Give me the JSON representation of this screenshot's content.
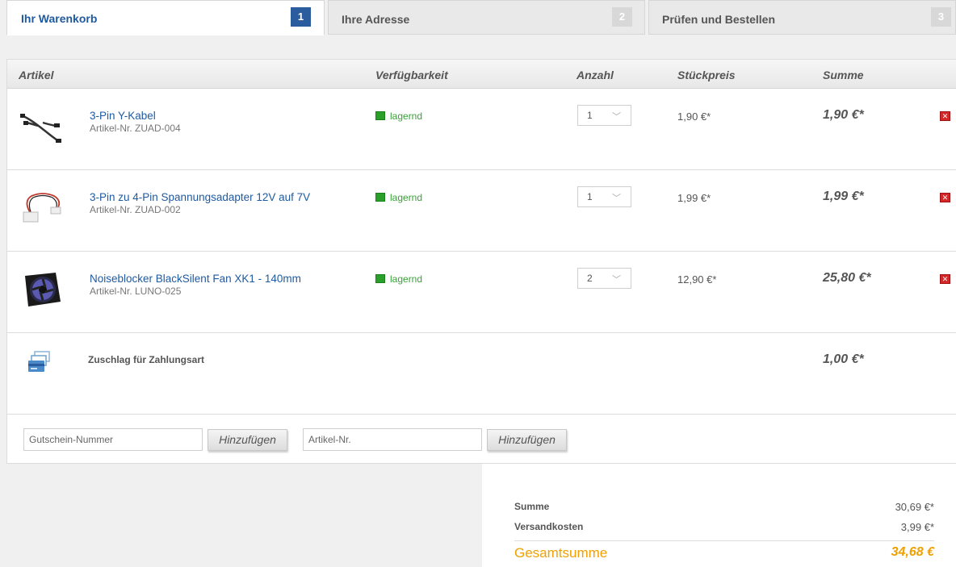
{
  "tabs": [
    {
      "label": "Ihr Warenkorb",
      "num": "1"
    },
    {
      "label": "Ihre Adresse",
      "num": "2"
    },
    {
      "label": "Prüfen und Bestellen",
      "num": "3"
    }
  ],
  "table": {
    "headers": {
      "artikel": "Artikel",
      "verfuegbarkeit": "Verfügbarkeit",
      "anzahl": "Anzahl",
      "stueckpreis": "Stückpreis",
      "summe": "Summe"
    },
    "items": [
      {
        "name": "3-Pin Y-Kabel",
        "number": "Artikel-Nr. ZUAD-004",
        "stock": "lagernd",
        "qty": "1",
        "unit_price": "1,90 €*",
        "sum": "1,90 €*"
      },
      {
        "name": "3-Pin zu 4-Pin Spannungsadapter 12V auf 7V",
        "number": "Artikel-Nr. ZUAD-002",
        "stock": "lagernd",
        "qty": "1",
        "unit_price": "1,99 €*",
        "sum": "1,99 €*"
      },
      {
        "name": "Noiseblocker BlackSilent Fan XK1 - 140mm",
        "number": "Artikel-Nr. LUNO-025",
        "stock": "lagernd",
        "qty": "2",
        "unit_price": "12,90 €*",
        "sum": "25,80 €*"
      }
    ],
    "surcharge": {
      "label": "Zuschlag für Zahlungsart",
      "sum": "1,00 €*"
    }
  },
  "vouchers": {
    "coupon_placeholder": "Gutschein-Nummer",
    "coupon_button": "Hinzufügen",
    "article_placeholder": "Artikel-Nr.",
    "article_button": "Hinzufügen"
  },
  "totals": {
    "sum_label": "Summe",
    "sum_value": "30,69 €*",
    "shipping_label": "Versandkosten",
    "shipping_value": "3,99 €*",
    "grand_label": "Gesamtsumme",
    "grand_value": "34,68 €"
  },
  "icons": {
    "delete": "delete-icon",
    "stock": "stock-indicator-icon",
    "payment": "payment-card-icon",
    "dropdown": "chevron-down-icon"
  },
  "colors": {
    "accent": "#1f5aa0",
    "stock": "#2aa02a",
    "delete": "#d62828",
    "total": "#f0a000"
  }
}
